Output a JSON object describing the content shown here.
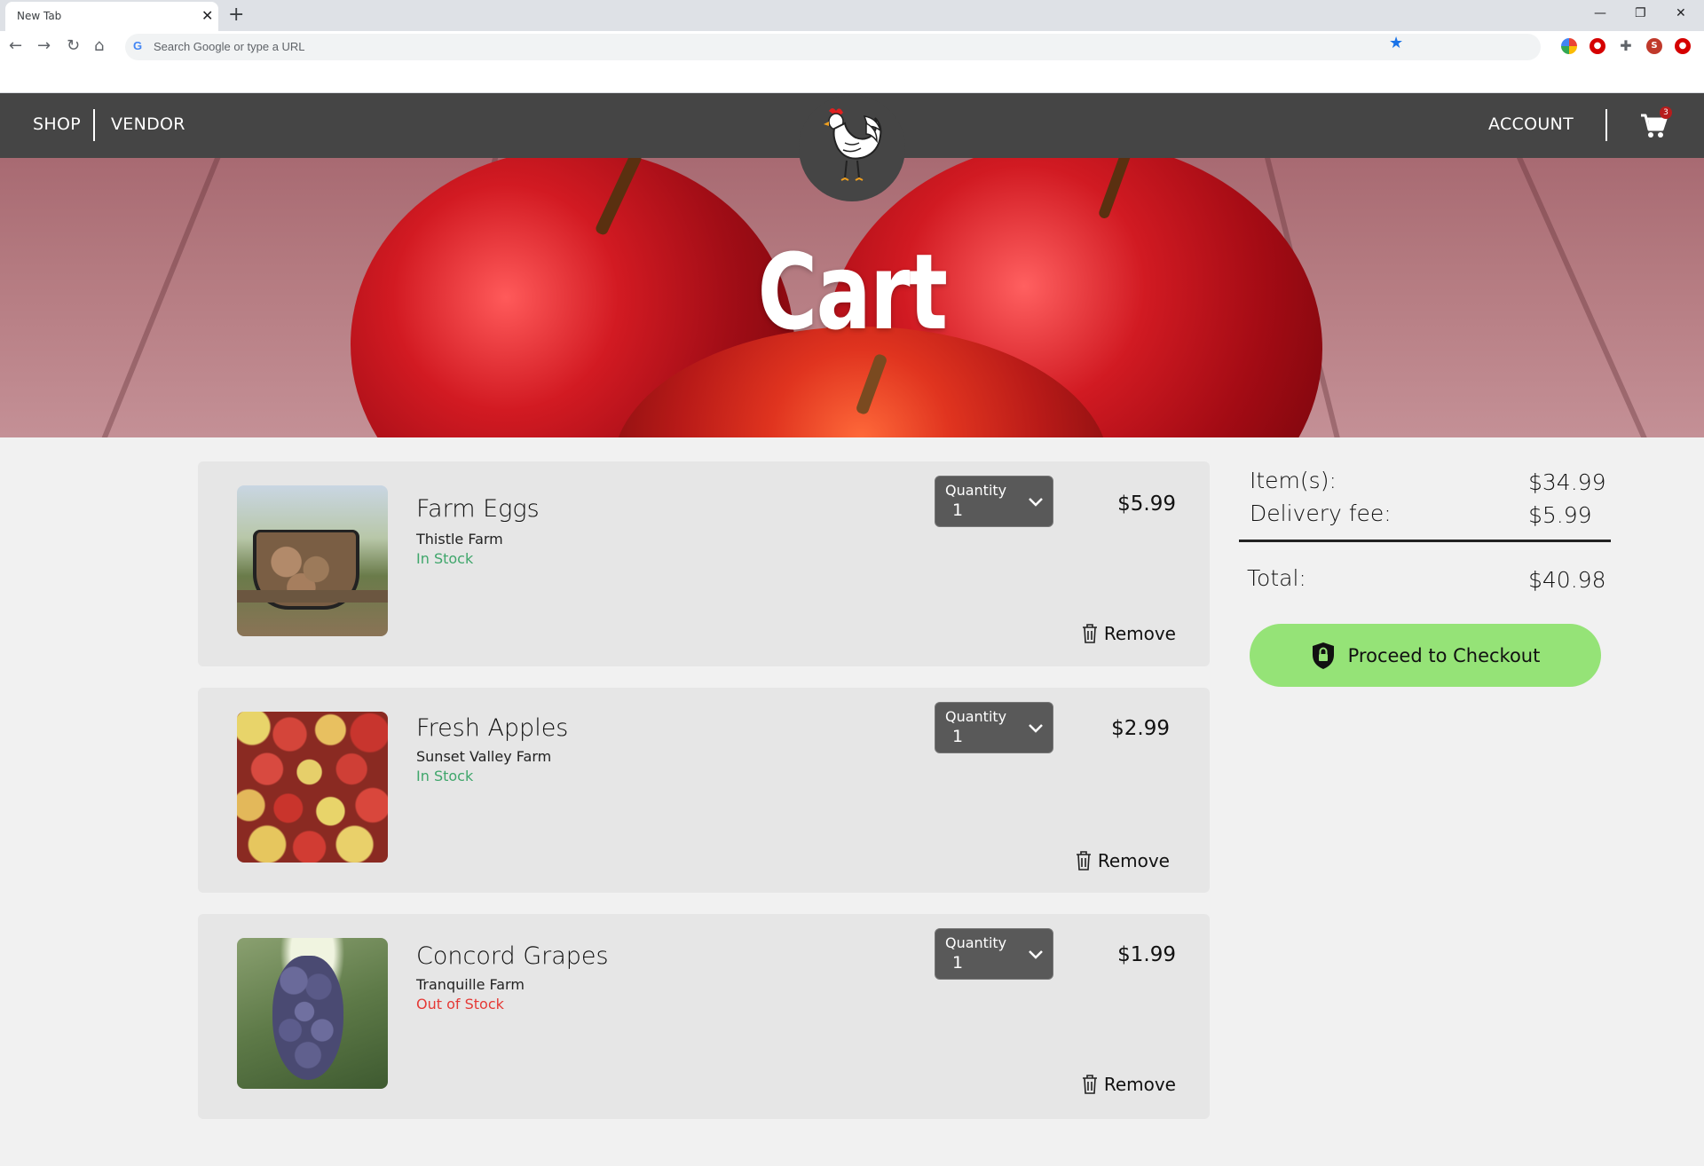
{
  "browser": {
    "tab_title": "New Tab",
    "omnibox_placeholder": "Search Google or type a URL",
    "profile_initial": "S"
  },
  "nav": {
    "shop_label": "SHOP",
    "vendor_label": "VENDOR",
    "account_label": "ACCOUNT",
    "cart_count": "3"
  },
  "hero": {
    "title": "Cart"
  },
  "items": [
    {
      "name": "Farm Eggs",
      "farm": "Thistle Farm",
      "stock": "In Stock",
      "stock_color": "#3fa66b",
      "quantity_label": "Quantity",
      "quantity": "1",
      "price": "$5.99",
      "remove_label": "Remove"
    },
    {
      "name": "Fresh Apples",
      "farm": "Sunset Valley Farm",
      "stock": "In Stock",
      "stock_color": "#3fa66b",
      "quantity_label": "Quantity",
      "quantity": "1",
      "price": "$2.99",
      "remove_label": "Remove"
    },
    {
      "name": "Concord Grapes",
      "farm": "Tranquille Farm",
      "stock": "Out of Stock",
      "stock_color": "#e53935",
      "quantity_label": "Quantity",
      "quantity": "1",
      "price": "$1.99",
      "remove_label": "Remove"
    }
  ],
  "summary": {
    "items_label": "Item(s):",
    "items_value": "$34.99",
    "delivery_label": "Delivery fee:",
    "delivery_value": "$5.99",
    "total_label": "Total:",
    "total_value": "$40.98",
    "checkout_label": "Proceed to Checkout"
  },
  "colors": {
    "nav_bg": "#454545",
    "checkout_bg": "#95e377",
    "in_stock": "#3fa66b",
    "out_of_stock": "#e53935"
  },
  "icons": [
    "back-icon",
    "forward-icon",
    "reload-icon",
    "home-icon",
    "google-icon",
    "bookmark-star-icon",
    "cart-icon",
    "rooster-logo-icon",
    "chevron-down-icon",
    "trash-icon",
    "lock-shield-icon"
  ]
}
